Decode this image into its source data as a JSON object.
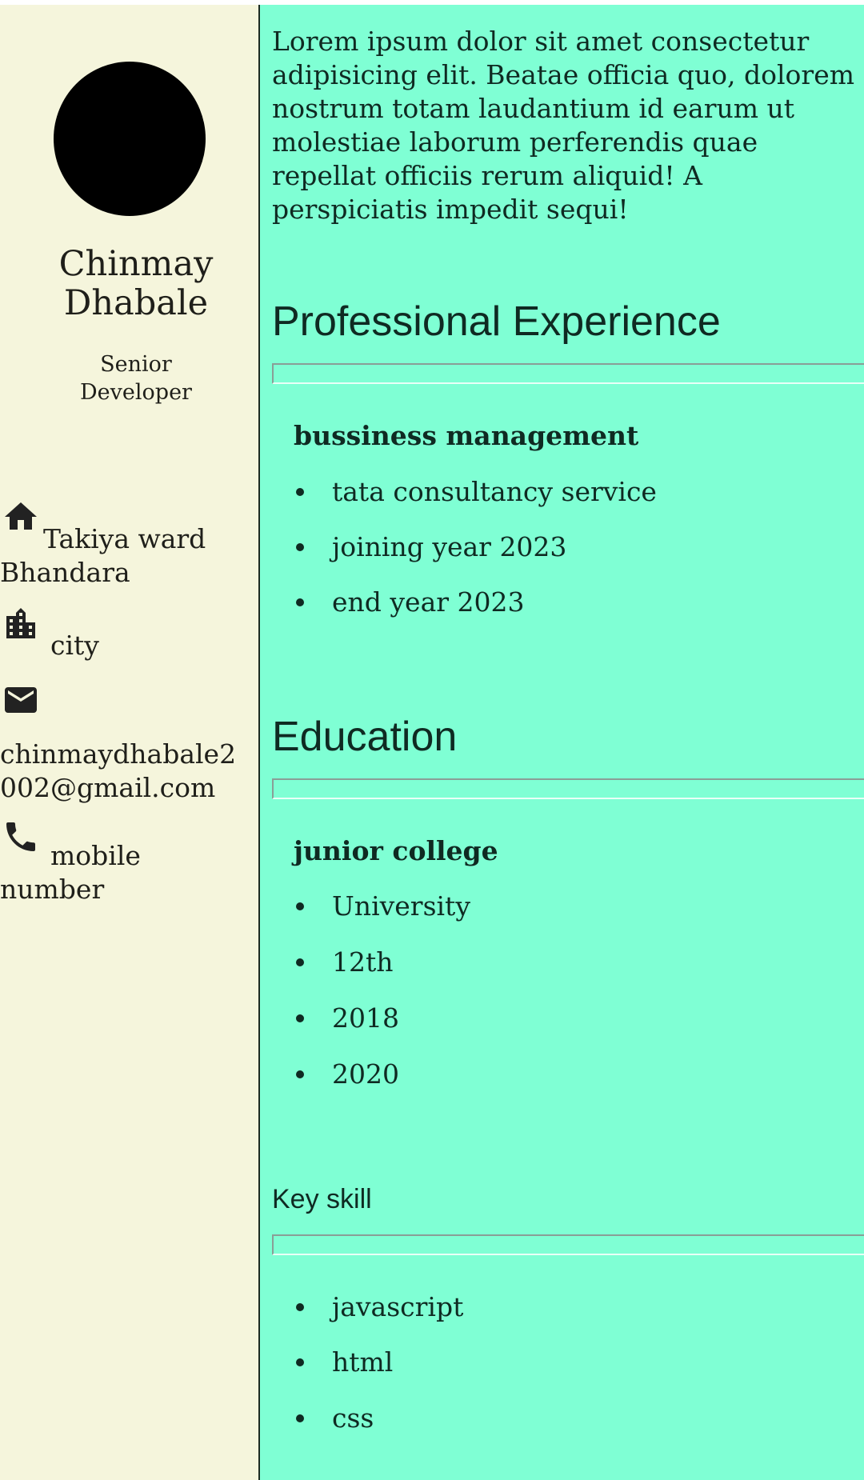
{
  "profile": {
    "name_first": "Chinmay",
    "name_last": "Dhabale",
    "title_line1": "Senior",
    "title_line2": "Developer"
  },
  "contact": {
    "address_line1": "Takiya ward",
    "address_line2": "Bhandara",
    "city": "city",
    "email_line1": "chinmaydhabale2",
    "email_line2": "002@gmail.com",
    "phone_line1": "mobile",
    "phone_line2": "number"
  },
  "about": "Lorem ipsum dolor sit amet consectetur adipisicing elit. Beatae officia quo, dolorem nostrum totam laudantium id earum ut molestiae laborum perferendis quae repellat officiis rerum aliquid! A perspiciatis impedit sequi!",
  "experience": {
    "heading": "Professional Experience",
    "role": "bussiness management",
    "items": [
      "tata consultancy service",
      "joining year 2023",
      "end year 2023"
    ]
  },
  "education": {
    "heading": "Education",
    "school": "junior college",
    "items": [
      "University",
      "12th",
      "2018",
      "2020"
    ]
  },
  "skills": {
    "heading": "Key skill",
    "items": [
      "javascript",
      "html",
      "css"
    ]
  },
  "colors": {
    "sidebar": "#f5f5dc",
    "main": "#7fffd4"
  }
}
